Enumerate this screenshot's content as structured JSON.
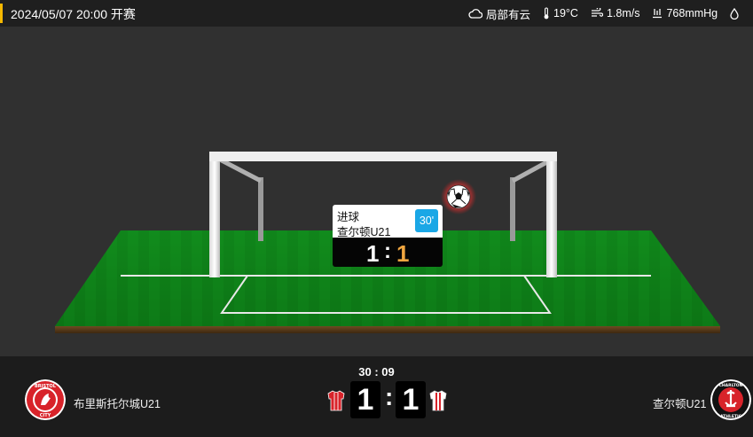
{
  "header": {
    "datetime": "2024/05/07 20:00",
    "status": "开赛",
    "accent_color": "#f5b800"
  },
  "weather": {
    "condition": "局部有云",
    "condition_icon": "cloud-icon",
    "temperature": "19°C",
    "temperature_icon": "thermometer-icon",
    "wind": "1.8m/s",
    "wind_icon": "wind-icon",
    "pressure": "768mmHg",
    "pressure_icon": "pressure-icon",
    "extra_icon": "humidity-icon"
  },
  "event": {
    "type": "进球",
    "team": "查尔顿U21",
    "minute": "30'",
    "score_home": "1",
    "score_sep": ":",
    "score_away": "1",
    "minute_color": "#1aa7e6",
    "away_score_color": "#f0a640"
  },
  "match": {
    "clock": "30 : 09",
    "home_team": "布里斯托尔城U21",
    "away_team": "查尔顿U21",
    "home_score": "1",
    "away_score": "1",
    "score_sep": ":",
    "home_badge_icon": "bristol-city-crest-icon",
    "away_badge_icon": "charlton-athletic-crest-icon",
    "home_kit_color": "#d8232a",
    "away_kit_color": "#d8232a"
  }
}
